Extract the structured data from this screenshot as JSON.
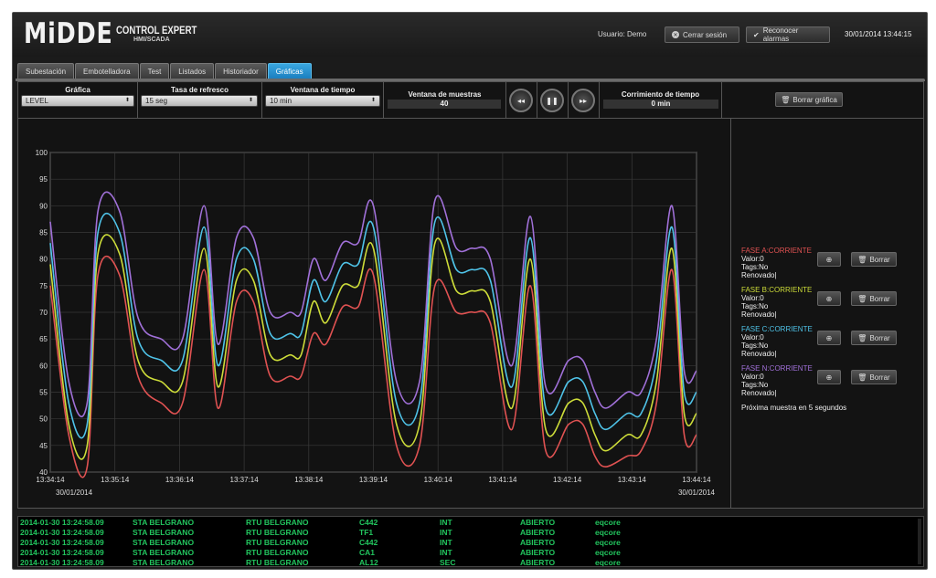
{
  "brand": {
    "logo": "MiDDE",
    "line1": "CONTROL EXPERT",
    "line2": "HMI/SCADA"
  },
  "header": {
    "user_label": "Usuario: Demo",
    "logout_label": "Cerrar sesión",
    "ack_alarms_label": "Reconocer alarmas",
    "datetime": "30/01/2014 13:44:15"
  },
  "tabs": [
    {
      "label": "Subestación",
      "active": false
    },
    {
      "label": "Embotelladora",
      "active": false
    },
    {
      "label": "Test",
      "active": false
    },
    {
      "label": "Listados",
      "active": false
    },
    {
      "label": "Historiador",
      "active": false
    },
    {
      "label": "Gráficas",
      "active": true
    }
  ],
  "controls": {
    "grafica": {
      "label": "Gráfica",
      "value": "LEVEL"
    },
    "tasa": {
      "label": "Tasa de refresco",
      "value": "15 seg"
    },
    "ventana": {
      "label": "Ventana de tiempo",
      "value": "10 min"
    },
    "muestras": {
      "label": "Ventana de muestras",
      "value": "40"
    },
    "corrimiento": {
      "label": "Corrimiento de tiempo",
      "value": "0 min"
    },
    "rewind_icon": "rewind-icon",
    "pause_icon": "pause-icon",
    "forward_icon": "fast-forward-icon",
    "clear_label": "Borrar gráfica"
  },
  "chart_data": {
    "type": "line",
    "x": [
      "13:34:14",
      "13:35:14",
      "13:36:14",
      "13:37:14",
      "13:38:14",
      "13:39:14",
      "13:40:14",
      "13:41:14",
      "13:42:14",
      "13:43:14",
      "13:44:14"
    ],
    "date_left": "30/01/2014",
    "date_right": "30/01/2014",
    "ylim": [
      40,
      100
    ],
    "yticks": [
      40,
      45,
      50,
      55,
      60,
      65,
      70,
      75,
      80,
      85,
      90,
      95,
      100
    ],
    "grid": true,
    "series": [
      {
        "name": "FASE A:CORRIENTE",
        "color": "#e05252",
        "points": [
          [
            0,
            75
          ],
          [
            0.12,
            47
          ],
          [
            0.24,
            41
          ],
          [
            0.31,
            77
          ],
          [
            0.45,
            77
          ],
          [
            0.57,
            58
          ],
          [
            0.72,
            53
          ],
          [
            0.86,
            53
          ],
          [
            1.0,
            78
          ],
          [
            1.09,
            52
          ],
          [
            1.21,
            72
          ],
          [
            1.32,
            72
          ],
          [
            1.43,
            58
          ],
          [
            1.56,
            58
          ],
          [
            1.63,
            58
          ],
          [
            1.71,
            66
          ],
          [
            1.79,
            64
          ],
          [
            1.9,
            71
          ],
          [
            2.0,
            71
          ],
          [
            2.1,
            77
          ],
          [
            2.25,
            45
          ],
          [
            2.4,
            45
          ],
          [
            2.5,
            75
          ],
          [
            2.64,
            70
          ],
          [
            2.75,
            70
          ],
          [
            2.86,
            68
          ],
          [
            3.0,
            48
          ],
          [
            3.12,
            75
          ],
          [
            3.22,
            44
          ],
          [
            3.37,
            49
          ],
          [
            3.46,
            49
          ],
          [
            3.54,
            43
          ],
          [
            3.61,
            41
          ],
          [
            3.75,
            43
          ],
          [
            3.84,
            44
          ],
          [
            3.94,
            53
          ],
          [
            4.04,
            78
          ],
          [
            4.12,
            47
          ],
          [
            4.2,
            47
          ]
        ]
      },
      {
        "name": "FASE B:CORRIENTE",
        "color": "#cddc39",
        "points": [
          [
            0,
            79
          ],
          [
            0.12,
            49
          ],
          [
            0.24,
            45
          ],
          [
            0.31,
            81
          ],
          [
            0.45,
            81
          ],
          [
            0.57,
            61
          ],
          [
            0.72,
            57
          ],
          [
            0.86,
            57
          ],
          [
            1.0,
            82
          ],
          [
            1.09,
            56
          ],
          [
            1.21,
            76
          ],
          [
            1.32,
            76
          ],
          [
            1.43,
            62
          ],
          [
            1.56,
            62
          ],
          [
            1.63,
            62
          ],
          [
            1.71,
            72
          ],
          [
            1.79,
            68
          ],
          [
            1.9,
            75
          ],
          [
            2.0,
            75
          ],
          [
            2.1,
            82
          ],
          [
            2.25,
            49
          ],
          [
            2.4,
            49
          ],
          [
            2.5,
            83
          ],
          [
            2.64,
            74
          ],
          [
            2.75,
            74
          ],
          [
            2.86,
            72
          ],
          [
            3.0,
            52
          ],
          [
            3.12,
            80
          ],
          [
            3.22,
            48
          ],
          [
            3.37,
            53
          ],
          [
            3.46,
            53
          ],
          [
            3.54,
            47
          ],
          [
            3.61,
            44
          ],
          [
            3.75,
            47
          ],
          [
            3.84,
            47
          ],
          [
            3.94,
            57
          ],
          [
            4.04,
            82
          ],
          [
            4.12,
            51
          ],
          [
            4.2,
            51
          ]
        ]
      },
      {
        "name": "FASE C:CORRIENTE",
        "color": "#4fc3e8",
        "points": [
          [
            0,
            83
          ],
          [
            0.12,
            53
          ],
          [
            0.24,
            49
          ],
          [
            0.31,
            85
          ],
          [
            0.45,
            85
          ],
          [
            0.57,
            65
          ],
          [
            0.72,
            61
          ],
          [
            0.86,
            61
          ],
          [
            1.0,
            86
          ],
          [
            1.09,
            60
          ],
          [
            1.21,
            80
          ],
          [
            1.32,
            80
          ],
          [
            1.43,
            66
          ],
          [
            1.56,
            66
          ],
          [
            1.63,
            66
          ],
          [
            1.71,
            76
          ],
          [
            1.79,
            72
          ],
          [
            1.9,
            79
          ],
          [
            2.0,
            79
          ],
          [
            2.1,
            86
          ],
          [
            2.25,
            53
          ],
          [
            2.4,
            53
          ],
          [
            2.5,
            87
          ],
          [
            2.64,
            78
          ],
          [
            2.75,
            78
          ],
          [
            2.86,
            76
          ],
          [
            3.0,
            56
          ],
          [
            3.12,
            84
          ],
          [
            3.22,
            52
          ],
          [
            3.37,
            57
          ],
          [
            3.46,
            57
          ],
          [
            3.54,
            51
          ],
          [
            3.61,
            48
          ],
          [
            3.75,
            51
          ],
          [
            3.84,
            51
          ],
          [
            3.94,
            61
          ],
          [
            4.04,
            86
          ],
          [
            4.12,
            55
          ],
          [
            4.2,
            55
          ]
        ]
      },
      {
        "name": "FASE N:CORRIENTE",
        "color": "#a070d8",
        "points": [
          [
            0,
            87
          ],
          [
            0.12,
            57
          ],
          [
            0.24,
            53
          ],
          [
            0.31,
            89
          ],
          [
            0.45,
            89
          ],
          [
            0.57,
            69
          ],
          [
            0.72,
            65
          ],
          [
            0.86,
            65
          ],
          [
            1.0,
            90
          ],
          [
            1.09,
            64
          ],
          [
            1.21,
            84
          ],
          [
            1.32,
            84
          ],
          [
            1.43,
            70
          ],
          [
            1.56,
            70
          ],
          [
            1.63,
            70
          ],
          [
            1.71,
            80
          ],
          [
            1.79,
            76
          ],
          [
            1.9,
            83
          ],
          [
            2.0,
            83
          ],
          [
            2.1,
            90
          ],
          [
            2.25,
            57
          ],
          [
            2.4,
            57
          ],
          [
            2.5,
            91
          ],
          [
            2.64,
            82
          ],
          [
            2.75,
            82
          ],
          [
            2.86,
            80
          ],
          [
            3.0,
            60
          ],
          [
            3.12,
            88
          ],
          [
            3.22,
            56
          ],
          [
            3.37,
            61
          ],
          [
            3.46,
            61
          ],
          [
            3.54,
            55
          ],
          [
            3.61,
            52
          ],
          [
            3.75,
            55
          ],
          [
            3.84,
            55
          ],
          [
            3.94,
            65
          ],
          [
            4.04,
            90
          ],
          [
            4.12,
            59
          ],
          [
            4.2,
            59
          ]
        ]
      }
    ]
  },
  "legend": [
    {
      "name": "FASE A:CORRIENTE",
      "color": "#e05252",
      "valor": "Valor:0",
      "tags": "Tags:No",
      "renovado": "Renovado|"
    },
    {
      "name": "FASE B:CORRIENTE",
      "color": "#cddc39",
      "valor": "Valor:0",
      "tags": "Tags:No",
      "renovado": "Renovado|"
    },
    {
      "name": "FASE C:CORRIENTE",
      "color": "#4fc3e8",
      "valor": "Valor:0",
      "tags": "Tags:No",
      "renovado": "Renovado|"
    },
    {
      "name": "FASE N:CORRIENTE",
      "color": "#a070d8",
      "valor": "Valor:0",
      "tags": "Tags:No",
      "renovado": "Renovado|"
    }
  ],
  "legend_actions": {
    "add_icon": "plus-icon",
    "delete_label": "Borrar"
  },
  "next_sample": "Próxima muestra en 5 segundos",
  "log": [
    [
      "2014-01-30 13:24:58.09",
      "STA BELGRANO",
      "RTU BELGRANO",
      "C442",
      "INT",
      "ABIERTO",
      "eqcore"
    ],
    [
      "2014-01-30 13:24:58.09",
      "STA BELGRANO",
      "RTU BELGRANO",
      "TF1",
      "INT",
      "ABIERTO",
      "eqcore"
    ],
    [
      "2014-01-30 13:24:58.09",
      "STA BELGRANO",
      "RTU BELGRANO",
      "C442",
      "INT",
      "ABIERTO",
      "eqcore"
    ],
    [
      "2014-01-30 13:24:58.09",
      "STA BELGRANO",
      "RTU BELGRANO",
      "CA1",
      "INT",
      "ABIERTO",
      "eqcore"
    ],
    [
      "2014-01-30 13:24:58.09",
      "STA BELGRANO",
      "RTU BELGRANO",
      "AL12",
      "SEC",
      "ABIERTO",
      "eqcore"
    ]
  ]
}
